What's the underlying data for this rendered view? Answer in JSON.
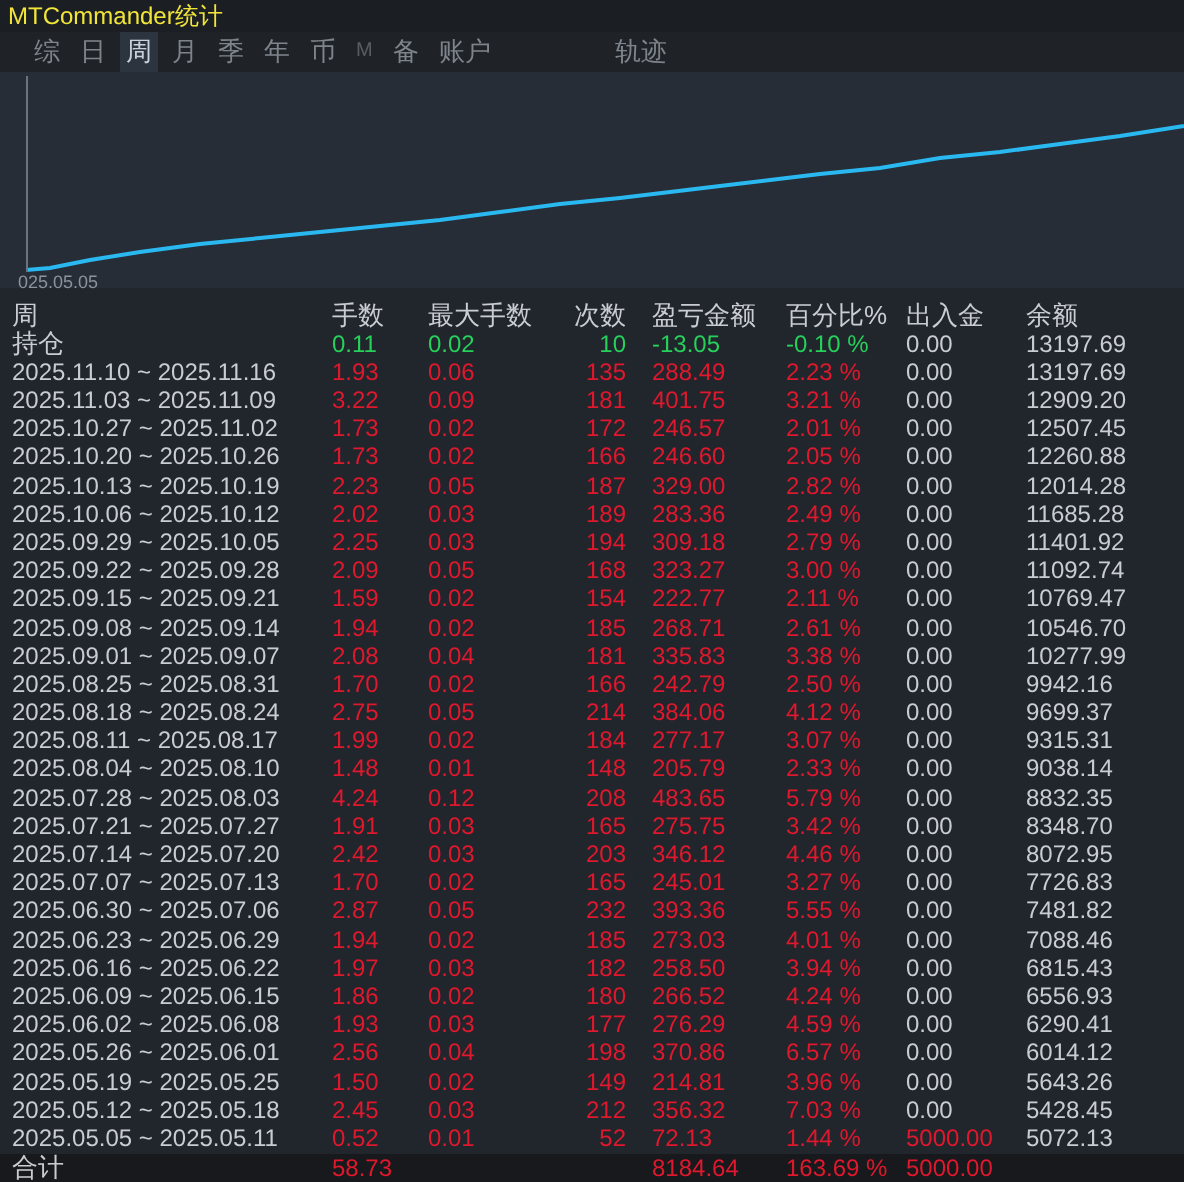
{
  "window": {
    "title": "MTCommander统计"
  },
  "tabs": [
    {
      "label": "综",
      "selected": false,
      "disabled": false
    },
    {
      "label": "日",
      "selected": false,
      "disabled": false
    },
    {
      "label": "周",
      "selected": true,
      "disabled": false
    },
    {
      "label": "月",
      "selected": false,
      "disabled": false
    },
    {
      "label": "季",
      "selected": false,
      "disabled": false
    },
    {
      "label": "年",
      "selected": false,
      "disabled": false
    },
    {
      "label": "币",
      "selected": false,
      "disabled": false
    },
    {
      "label": "M",
      "selected": false,
      "disabled": true
    },
    {
      "label": "备",
      "selected": false,
      "disabled": false
    },
    {
      "label": "账户",
      "selected": false,
      "disabled": false
    }
  ],
  "track_tab": {
    "label": "轨迹",
    "selected": false
  },
  "chart": {
    "start_label": "025.05.05"
  },
  "table": {
    "columns": [
      "周",
      "手数",
      "最大手数",
      "次数",
      "盈亏金额",
      "百分比%",
      "出入金",
      "余额"
    ],
    "rows": [
      {
        "cells": [
          "持仓",
          "0.11",
          "0.02",
          "10",
          "-13.05",
          "-0.10 %",
          "0.00",
          "13197.69"
        ],
        "negative": true,
        "deposit": false
      },
      {
        "cells": [
          "2025.11.10 ~ 2025.11.16",
          "1.93",
          "0.06",
          "135",
          "288.49",
          "2.23 %",
          "0.00",
          "13197.69"
        ],
        "negative": false,
        "deposit": false
      },
      {
        "cells": [
          "2025.11.03 ~ 2025.11.09",
          "3.22",
          "0.09",
          "181",
          "401.75",
          "3.21 %",
          "0.00",
          "12909.20"
        ],
        "negative": false,
        "deposit": false
      },
      {
        "cells": [
          "2025.10.27 ~ 2025.11.02",
          "1.73",
          "0.02",
          "172",
          "246.57",
          "2.01 %",
          "0.00",
          "12507.45"
        ],
        "negative": false,
        "deposit": false
      },
      {
        "cells": [
          "2025.10.20 ~ 2025.10.26",
          "1.73",
          "0.02",
          "166",
          "246.60",
          "2.05 %",
          "0.00",
          "12260.88"
        ],
        "negative": false,
        "deposit": false
      },
      {
        "cells": [
          "2025.10.13 ~ 2025.10.19",
          "2.23",
          "0.05",
          "187",
          "329.00",
          "2.82 %",
          "0.00",
          "12014.28"
        ],
        "negative": false,
        "deposit": false
      },
      {
        "cells": [
          "2025.10.06 ~ 2025.10.12",
          "2.02",
          "0.03",
          "189",
          "283.36",
          "2.49 %",
          "0.00",
          "11685.28"
        ],
        "negative": false,
        "deposit": false
      },
      {
        "cells": [
          "2025.09.29 ~ 2025.10.05",
          "2.25",
          "0.03",
          "194",
          "309.18",
          "2.79 %",
          "0.00",
          "11401.92"
        ],
        "negative": false,
        "deposit": false
      },
      {
        "cells": [
          "2025.09.22 ~ 2025.09.28",
          "2.09",
          "0.05",
          "168",
          "323.27",
          "3.00 %",
          "0.00",
          "11092.74"
        ],
        "negative": false,
        "deposit": false
      },
      {
        "cells": [
          "2025.09.15 ~ 2025.09.21",
          "1.59",
          "0.02",
          "154",
          "222.77",
          "2.11 %",
          "0.00",
          "10769.47"
        ],
        "negative": false,
        "deposit": false
      },
      {
        "cells": [
          "2025.09.08 ~ 2025.09.14",
          "1.94",
          "0.02",
          "185",
          "268.71",
          "2.61 %",
          "0.00",
          "10546.70"
        ],
        "negative": false,
        "deposit": false
      },
      {
        "cells": [
          "2025.09.01 ~ 2025.09.07",
          "2.08",
          "0.04",
          "181",
          "335.83",
          "3.38 %",
          "0.00",
          "10277.99"
        ],
        "negative": false,
        "deposit": false
      },
      {
        "cells": [
          "2025.08.25 ~ 2025.08.31",
          "1.70",
          "0.02",
          "166",
          "242.79",
          "2.50 %",
          "0.00",
          "9942.16"
        ],
        "negative": false,
        "deposit": false
      },
      {
        "cells": [
          "2025.08.18 ~ 2025.08.24",
          "2.75",
          "0.05",
          "214",
          "384.06",
          "4.12 %",
          "0.00",
          "9699.37"
        ],
        "negative": false,
        "deposit": false
      },
      {
        "cells": [
          "2025.08.11 ~ 2025.08.17",
          "1.99",
          "0.02",
          "184",
          "277.17",
          "3.07 %",
          "0.00",
          "9315.31"
        ],
        "negative": false,
        "deposit": false
      },
      {
        "cells": [
          "2025.08.04 ~ 2025.08.10",
          "1.48",
          "0.01",
          "148",
          "205.79",
          "2.33 %",
          "0.00",
          "9038.14"
        ],
        "negative": false,
        "deposit": false
      },
      {
        "cells": [
          "2025.07.28 ~ 2025.08.03",
          "4.24",
          "0.12",
          "208",
          "483.65",
          "5.79 %",
          "0.00",
          "8832.35"
        ],
        "negative": false,
        "deposit": false
      },
      {
        "cells": [
          "2025.07.21 ~ 2025.07.27",
          "1.91",
          "0.03",
          "165",
          "275.75",
          "3.42 %",
          "0.00",
          "8348.70"
        ],
        "negative": false,
        "deposit": false
      },
      {
        "cells": [
          "2025.07.14 ~ 2025.07.20",
          "2.42",
          "0.03",
          "203",
          "346.12",
          "4.46 %",
          "0.00",
          "8072.95"
        ],
        "negative": false,
        "deposit": false
      },
      {
        "cells": [
          "2025.07.07 ~ 2025.07.13",
          "1.70",
          "0.02",
          "165",
          "245.01",
          "3.27 %",
          "0.00",
          "7726.83"
        ],
        "negative": false,
        "deposit": false
      },
      {
        "cells": [
          "2025.06.30 ~ 2025.07.06",
          "2.87",
          "0.05",
          "232",
          "393.36",
          "5.55 %",
          "0.00",
          "7481.82"
        ],
        "negative": false,
        "deposit": false
      },
      {
        "cells": [
          "2025.06.23 ~ 2025.06.29",
          "1.94",
          "0.02",
          "185",
          "273.03",
          "4.01 %",
          "0.00",
          "7088.46"
        ],
        "negative": false,
        "deposit": false
      },
      {
        "cells": [
          "2025.06.16 ~ 2025.06.22",
          "1.97",
          "0.03",
          "182",
          "258.50",
          "3.94 %",
          "0.00",
          "6815.43"
        ],
        "negative": false,
        "deposit": false
      },
      {
        "cells": [
          "2025.06.09 ~ 2025.06.15",
          "1.86",
          "0.02",
          "180",
          "266.52",
          "4.24 %",
          "0.00",
          "6556.93"
        ],
        "negative": false,
        "deposit": false
      },
      {
        "cells": [
          "2025.06.02 ~ 2025.06.08",
          "1.93",
          "0.03",
          "177",
          "276.29",
          "4.59 %",
          "0.00",
          "6290.41"
        ],
        "negative": false,
        "deposit": false
      },
      {
        "cells": [
          "2025.05.26 ~ 2025.06.01",
          "2.56",
          "0.04",
          "198",
          "370.86",
          "6.57 %",
          "0.00",
          "6014.12"
        ],
        "negative": false,
        "deposit": false
      },
      {
        "cells": [
          "2025.05.19 ~ 2025.05.25",
          "1.50",
          "0.02",
          "149",
          "214.81",
          "3.96 %",
          "0.00",
          "5643.26"
        ],
        "negative": false,
        "deposit": false
      },
      {
        "cells": [
          "2025.05.12 ~ 2025.05.18",
          "2.45",
          "0.03",
          "212",
          "356.32",
          "7.03 %",
          "0.00",
          "5428.45"
        ],
        "negative": false,
        "deposit": false
      },
      {
        "cells": [
          "2025.05.05 ~ 2025.05.11",
          "0.52",
          "0.01",
          "52",
          "72.13",
          "1.44 %",
          "5000.00",
          "5072.13"
        ],
        "negative": false,
        "deposit": true
      }
    ],
    "total": {
      "cells": [
        "合计",
        "58.73",
        null,
        null,
        "8184.64",
        "163.69 %",
        "5000.00",
        null
      ]
    }
  }
}
